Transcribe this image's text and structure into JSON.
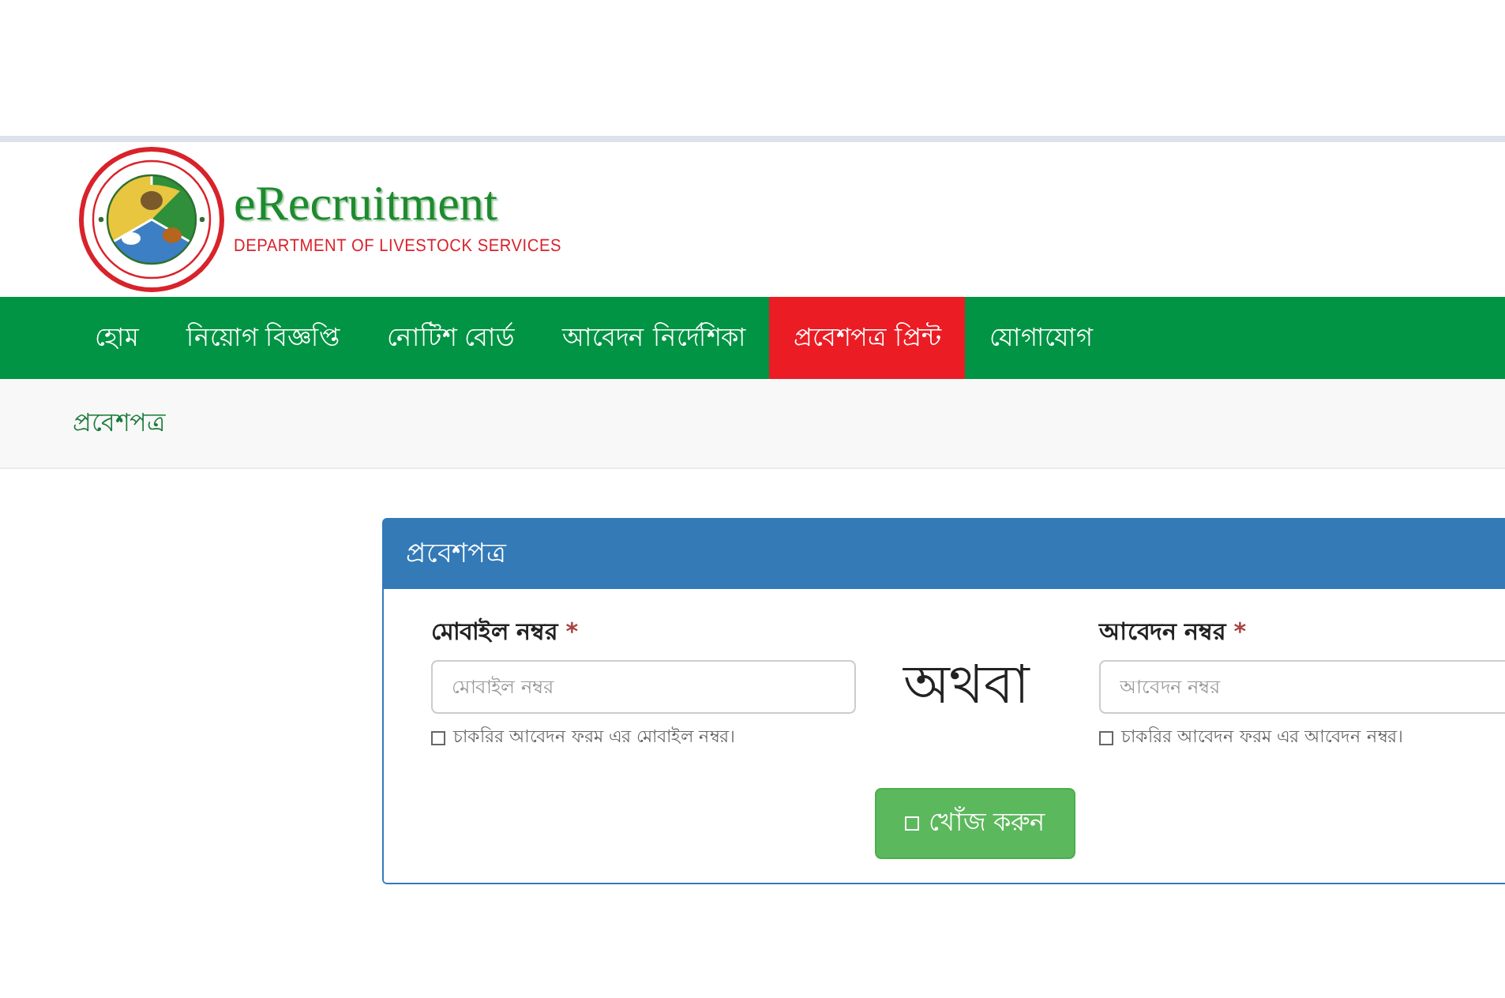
{
  "header": {
    "logo_title": "eRecruitment",
    "logo_subtitle": "DEPARTMENT OF LIVESTOCK SERVICES"
  },
  "nav": [
    {
      "label": "হোম",
      "selected": false
    },
    {
      "label": "নিয়োগ বিজ্ঞপ্তি",
      "selected": false
    },
    {
      "label": "নোটিশ বোর্ড",
      "selected": false
    },
    {
      "label": "আবেদন নির্দেশিকা",
      "selected": false
    },
    {
      "label": "প্রবেশপত্র প্রিন্ট",
      "selected": true
    },
    {
      "label": "যোগাযোগ",
      "selected": false
    }
  ],
  "breadcrumb": "প্রবেশপত্র",
  "panel": {
    "title": "প্রবেশপত্র",
    "fields": [
      {
        "label": "মোবাইল নম্বর",
        "required_mark": "*",
        "placeholder": "মোবাইল নম্বর",
        "help": "চাকরির আবেদন ফরম এর মোবাইল নম্বর।"
      },
      {
        "label": "আবেদন নম্বর",
        "required_mark": "*",
        "placeholder": "আবেদন নম্বর",
        "help": "চাকরির আবেদন ফরম এর আবেদন নম্বর।"
      }
    ],
    "separator": "অথবা",
    "button": "খোঁজ করুন"
  }
}
